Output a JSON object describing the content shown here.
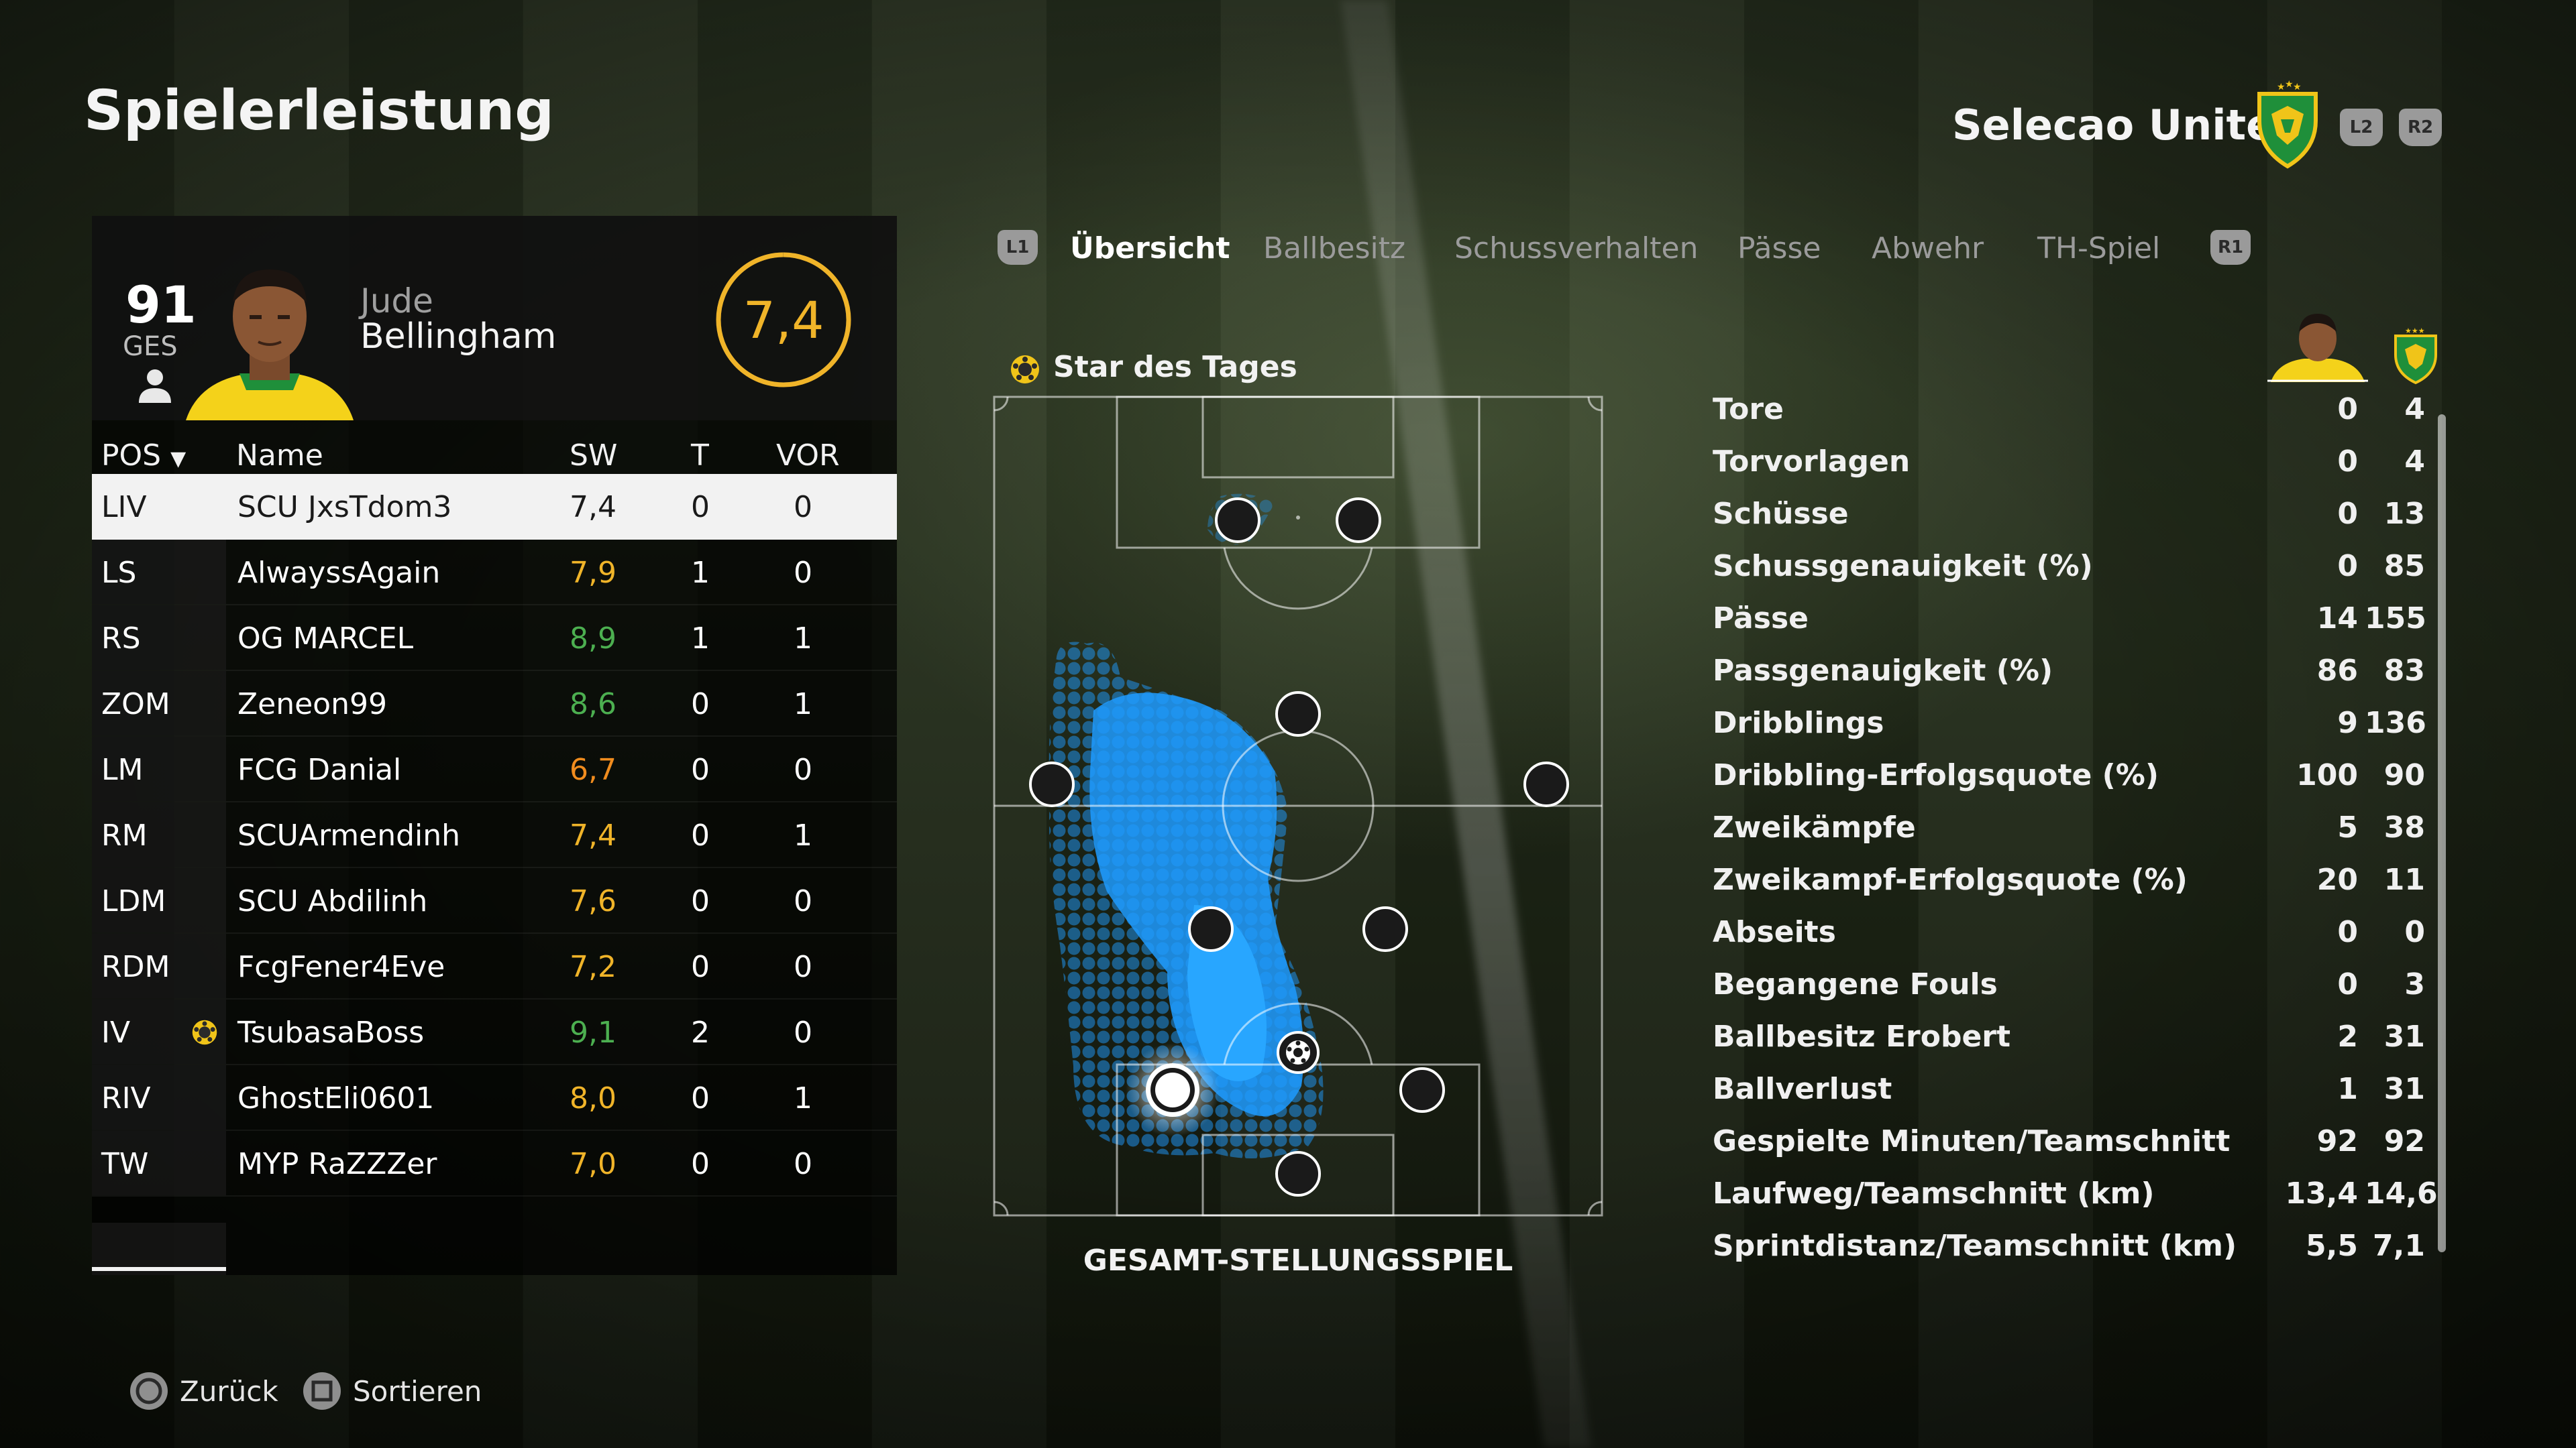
{
  "page_title": "Spielerleistung",
  "team": {
    "name": "Selecao United",
    "bumper_left": "L2",
    "bumper_right": "R2"
  },
  "player": {
    "ovr": "91",
    "ovr_label": "GES",
    "first_name": "Jude",
    "last_name": "Bellingham",
    "match_rating": "7,4"
  },
  "table": {
    "headers": {
      "pos": "POS",
      "name": "Name",
      "rating": "SW",
      "goals": "T",
      "assists": "VOR"
    },
    "rows": [
      {
        "pos": "LIV",
        "name": "SCU JxsTdom3",
        "rating": "7,4",
        "goals": "0",
        "assists": "0",
        "color": "#1a1a1a"
      },
      {
        "pos": "LS",
        "name": "AlwayssAgain",
        "rating": "7,9",
        "goals": "1",
        "assists": "0",
        "color": "#f0b429"
      },
      {
        "pos": "RS",
        "name": "OG MARCEL",
        "rating": "8,9",
        "goals": "1",
        "assists": "1",
        "color": "#4caf50"
      },
      {
        "pos": "ZOM",
        "name": "Zeneon99",
        "rating": "8,6",
        "goals": "0",
        "assists": "1",
        "color": "#4caf50"
      },
      {
        "pos": "LM",
        "name": "FCG Danial",
        "rating": "6,7",
        "goals": "0",
        "assists": "0",
        "color": "#f08c1e"
      },
      {
        "pos": "RM",
        "name": "SCUArmendinh",
        "rating": "7,4",
        "goals": "0",
        "assists": "1",
        "color": "#f0b429"
      },
      {
        "pos": "LDM",
        "name": "SCU Abdilinh",
        "rating": "7,6",
        "goals": "0",
        "assists": "0",
        "color": "#f0b429"
      },
      {
        "pos": "RDM",
        "name": "FcgFener4Eve",
        "rating": "7,2",
        "goals": "0",
        "assists": "0",
        "color": "#f0b429"
      },
      {
        "pos": "IV",
        "name": "TsubasaBoss",
        "rating": "9,1",
        "goals": "2",
        "assists": "0",
        "color": "#4caf50",
        "star": true
      },
      {
        "pos": "RIV",
        "name": "GhostEli0601",
        "rating": "8,0",
        "goals": "0",
        "assists": "1",
        "color": "#f0b429"
      },
      {
        "pos": "TW",
        "name": "MYP RaZZZer",
        "rating": "7,0",
        "goals": "0",
        "assists": "0",
        "color": "#f0b429"
      }
    ]
  },
  "tabs": {
    "bumper_left": "L1",
    "bumper_right": "R1",
    "items": [
      "Übersicht",
      "Ballbesitz",
      "Schussverhalten",
      "Pässe",
      "Abwehr",
      "TH-Spiel"
    ],
    "active": 0
  },
  "pitch": {
    "star_label": "Star des Tages",
    "caption": "GESAMT-STELLUNGSSPIEL"
  },
  "stats": [
    {
      "label": "Tore",
      "player": "0",
      "team": "4"
    },
    {
      "label": "Torvorlagen",
      "player": "0",
      "team": "4"
    },
    {
      "label": "Schüsse",
      "player": "0",
      "team": "13"
    },
    {
      "label": "Schussgenauigkeit (%)",
      "player": "0",
      "team": "85"
    },
    {
      "label": "Pässe",
      "player": "14",
      "team": "155"
    },
    {
      "label": "Passgenauigkeit (%)",
      "player": "86",
      "team": "83"
    },
    {
      "label": "Dribblings",
      "player": "9",
      "team": "136"
    },
    {
      "label": "Dribbling-Erfolgsquote (%)",
      "player": "100",
      "team": "90"
    },
    {
      "label": "Zweikämpfe",
      "player": "5",
      "team": "38"
    },
    {
      "label": "Zweikampf-Erfolgsquote (%)",
      "player": "20",
      "team": "11"
    },
    {
      "label": "Abseits",
      "player": "0",
      "team": "0"
    },
    {
      "label": "Begangene Fouls",
      "player": "0",
      "team": "3"
    },
    {
      "label": "Ballbesitz Erobert",
      "player": "2",
      "team": "31"
    },
    {
      "label": "Ballverlust",
      "player": "1",
      "team": "31"
    },
    {
      "label": "Gespielte Minuten/Teamschnitt",
      "player": "92",
      "team": "92"
    },
    {
      "label": "Laufweg/Teamschnitt (km)",
      "player": "13,4",
      "team": "14,6"
    },
    {
      "label": "Sprintdistanz/Teamschnitt (km)",
      "player": "5,5",
      "team": "7,1"
    }
  ],
  "footer": {
    "back": "Zurück",
    "sort": "Sortieren"
  },
  "colors": {
    "accent": "#f0b429",
    "heatmap": "#1e9bff",
    "good": "#4caf50"
  }
}
